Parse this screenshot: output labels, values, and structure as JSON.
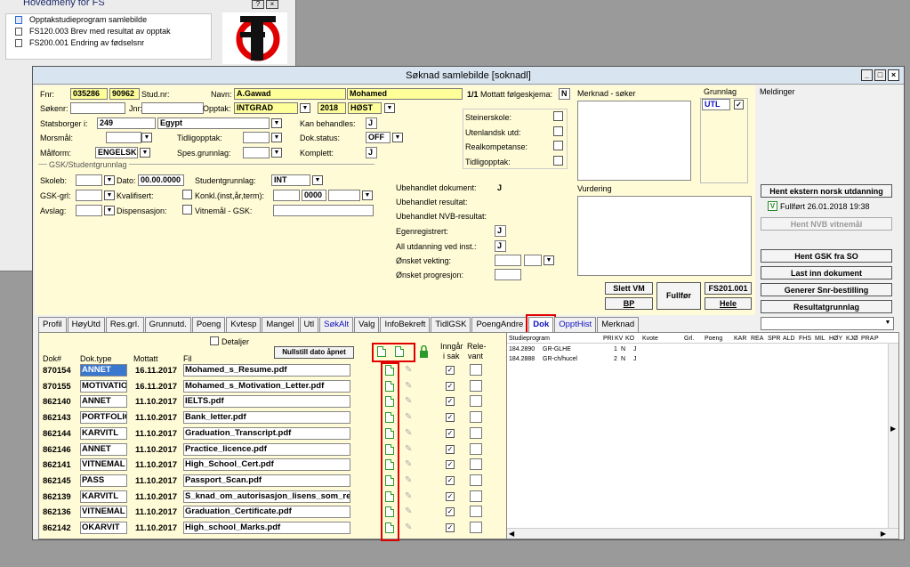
{
  "menu": {
    "title": "Hovedmeny for FS",
    "items": [
      "Opptakstudieprogram samlebilde",
      "FS120.003 Brev med resultat av opptak",
      "FS200.001 Endring av fødselsnr"
    ]
  },
  "window": {
    "title": "Søknad samlebilde  [soknadl]"
  },
  "form": {
    "fnr_label": "Fnr:",
    "fnr1": "035286",
    "fnr2": "90962",
    "studnr_label": "Stud.nr:",
    "navn_label": "Navn:",
    "etternavn": "A.Gawad",
    "fornavn": "Mohamed",
    "mottatt_text": "1/1",
    "mottatt_label": "Mottatt følgeskjema:",
    "mottatt_value": "N",
    "sokenr_label": "Søkenr:",
    "jnr_label": "Jnr:",
    "opptak_label": "Opptak:",
    "opptak_value": "INTGRAD",
    "ar": "2018",
    "termin": "HØST",
    "statsborger_label": "Statsborger i:",
    "statsborger_kode": "249",
    "statsborger_land": "Egypt",
    "kanbehandles_label": "Kan behandles:",
    "kanbehandles_value": "J",
    "morsmal_label": "Morsmål:",
    "tidligopptak_label": "Tidligopptak:",
    "dokstatus_label": "Dok.status:",
    "dokstatus_value": "OFF",
    "malform_label": "Målform:",
    "malform_value": "ENGELSK",
    "spesgrunnlag_label": "Spes.grunnlag:",
    "komplett_label": "Komplett:",
    "komplett_value": "J",
    "gsk_title": "GSK/Studentgrunnlag",
    "skoleb_label": "Skoleb:",
    "dato_label": "Dato:",
    "dato_value": "00.00.0000",
    "studentgrunnlag_label": "Studentgrunnlag:",
    "studentgrunnlag_value": "INT",
    "gskgrl_label": "GSK-grl:",
    "kvalifisert_label": "Kvalifisert:",
    "konkl_label": "Konkl.(inst,år,term):",
    "konkl_value": "0000",
    "avslag_label": "Avslag:",
    "dispensasjon_label": "Dispensasjon:",
    "vitnemal_label": "Vitnemål - GSK:",
    "steinerskole": "Steinerskole:",
    "utenlandsk": "Utenlandsk utd:",
    "realkompetanse": "Realkompetanse:",
    "tidligopptak2": "Tidligopptak:",
    "merknad_label": "Merknad - søker",
    "grunnlag_label": "Grunnlag",
    "grunnlag_value": "UTL",
    "vurdering_label": "Vurdering",
    "ubeh_dok_label": "Ubehandlet dokument:",
    "ubeh_dok_value": "J",
    "ubeh_res_label": "Ubehandlet resultat:",
    "ubeh_nvb_label": "Ubehandlet NVB-resultat:",
    "egenreg_label": "Egenregistrert:",
    "egenreg_value": "J",
    "allutd_label": "All utdanning ved inst.:",
    "allutd_value": "J",
    "vekting_label": "Ønsket vekting:",
    "progresjon_label": "Ønsket progresjon:",
    "slett_vm": "Slett VM",
    "bp": "BP",
    "fullfor": "Fullfør",
    "fs201": "FS201.001",
    "hele": "Hele"
  },
  "right": {
    "meldinger": "Meldinger",
    "hent_ekstern": "Hent ekstern norsk utdanning",
    "fullfort_check": "V",
    "fullfort": "Fullført 26.01.2018 19:38",
    "hent_nvb": "Hent NVB vitnemål",
    "hent_gsk": "Hent GSK fra SO",
    "last_inn": "Last inn dokument",
    "generer": "Generer Snr-bestilling",
    "resultat": "Resultatgrunnlag"
  },
  "tabs": [
    "Profil",
    "HøyUtd",
    "Res.grl.",
    "Grunnutd.",
    "Poeng",
    "Kvtesp",
    "Mangel",
    "Utl",
    "SøkAlt",
    "Valg",
    "InfoBekreft",
    "TidlGSK",
    "PoengAndre",
    "Dok",
    "OpptHist",
    "Merknad"
  ],
  "active_tab": "Dok",
  "docs": {
    "detaljer": "Detaljer",
    "nullstill": "Nullstill dato åpnet",
    "headers": {
      "dok": "Dok#",
      "type": "Dok.type",
      "mottatt": "Mottatt",
      "fil": "Fil",
      "inngar1": "Inngår",
      "inngar2": "i sak",
      "rele1": "Rele-",
      "rele2": "vant"
    },
    "rows": [
      {
        "nr": "870154",
        "type": "ANNET",
        "mottatt": "16.11.2017",
        "fil": "Mohamed_s_Resume.pdf"
      },
      {
        "nr": "870155",
        "type": "MOTIVATIO",
        "mottatt": "16.11.2017",
        "fil": "Mohamed_s_Motivation_Letter.pdf"
      },
      {
        "nr": "862140",
        "type": "ANNET",
        "mottatt": "11.10.2017",
        "fil": "IELTS.pdf"
      },
      {
        "nr": "862143",
        "type": "PORTFOLIC",
        "mottatt": "11.10.2017",
        "fil": "Bank_letter.pdf"
      },
      {
        "nr": "862144",
        "type": "KARVITL",
        "mottatt": "11.10.2017",
        "fil": "Graduation_Transcript.pdf"
      },
      {
        "nr": "862146",
        "type": "ANNET",
        "mottatt": "11.10.2017",
        "fil": "Practice_licence.pdf"
      },
      {
        "nr": "862141",
        "type": "VITNEMAL",
        "mottatt": "11.10.2017",
        "fil": "High_School_Cert.pdf"
      },
      {
        "nr": "862145",
        "type": "PASS",
        "mottatt": "11.10.2017",
        "fil": "Passport_Scan.pdf"
      },
      {
        "nr": "862139",
        "type": "KARVITL",
        "mottatt": "11.10.2017",
        "fil": "S_knad_om_autorisasjon_lisens_som_re"
      },
      {
        "nr": "862136",
        "type": "VITNEMAL",
        "mottatt": "11.10.2017",
        "fil": "Graduation_Certificate.pdf"
      },
      {
        "nr": "862142",
        "type": "OKARVIT",
        "mottatt": "11.10.2017",
        "fil": "High_school_Marks.pdf"
      }
    ]
  },
  "programs": {
    "headers": [
      "Studieprogram",
      "PRI",
      "KV",
      "KO",
      "Kvote",
      "Grl.",
      "Poeng",
      "KAR",
      "REA",
      "SPR",
      "ALD",
      "FHS",
      "MIL",
      "HØY",
      "KJØ",
      "PRA",
      "P"
    ],
    "rows": [
      {
        "kode": "184.2890",
        "navn": "GR-GLHE",
        "pri": "1",
        "kv": "N",
        "ko": "J"
      },
      {
        "kode": "184.2888",
        "navn": "GR-ch/hucel",
        "pri": "2",
        "kv": "N",
        "ko": "J"
      }
    ]
  }
}
